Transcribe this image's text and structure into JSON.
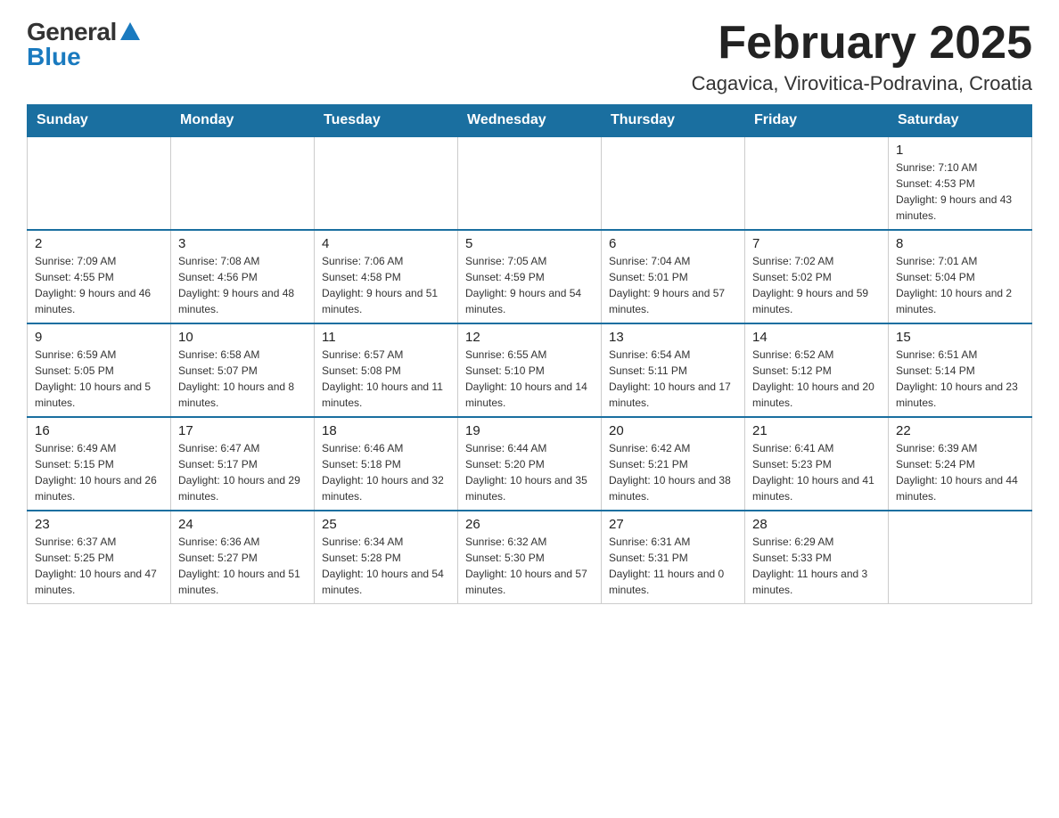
{
  "logo": {
    "general": "General",
    "blue": "Blue"
  },
  "header": {
    "month_year": "February 2025",
    "location": "Cagavica, Virovitica-Podravina, Croatia"
  },
  "weekdays": [
    "Sunday",
    "Monday",
    "Tuesday",
    "Wednesday",
    "Thursday",
    "Friday",
    "Saturday"
  ],
  "weeks": [
    [
      {
        "day": "",
        "info": ""
      },
      {
        "day": "",
        "info": ""
      },
      {
        "day": "",
        "info": ""
      },
      {
        "day": "",
        "info": ""
      },
      {
        "day": "",
        "info": ""
      },
      {
        "day": "",
        "info": ""
      },
      {
        "day": "1",
        "info": "Sunrise: 7:10 AM\nSunset: 4:53 PM\nDaylight: 9 hours and 43 minutes."
      }
    ],
    [
      {
        "day": "2",
        "info": "Sunrise: 7:09 AM\nSunset: 4:55 PM\nDaylight: 9 hours and 46 minutes."
      },
      {
        "day": "3",
        "info": "Sunrise: 7:08 AM\nSunset: 4:56 PM\nDaylight: 9 hours and 48 minutes."
      },
      {
        "day": "4",
        "info": "Sunrise: 7:06 AM\nSunset: 4:58 PM\nDaylight: 9 hours and 51 minutes."
      },
      {
        "day": "5",
        "info": "Sunrise: 7:05 AM\nSunset: 4:59 PM\nDaylight: 9 hours and 54 minutes."
      },
      {
        "day": "6",
        "info": "Sunrise: 7:04 AM\nSunset: 5:01 PM\nDaylight: 9 hours and 57 minutes."
      },
      {
        "day": "7",
        "info": "Sunrise: 7:02 AM\nSunset: 5:02 PM\nDaylight: 9 hours and 59 minutes."
      },
      {
        "day": "8",
        "info": "Sunrise: 7:01 AM\nSunset: 5:04 PM\nDaylight: 10 hours and 2 minutes."
      }
    ],
    [
      {
        "day": "9",
        "info": "Sunrise: 6:59 AM\nSunset: 5:05 PM\nDaylight: 10 hours and 5 minutes."
      },
      {
        "day": "10",
        "info": "Sunrise: 6:58 AM\nSunset: 5:07 PM\nDaylight: 10 hours and 8 minutes."
      },
      {
        "day": "11",
        "info": "Sunrise: 6:57 AM\nSunset: 5:08 PM\nDaylight: 10 hours and 11 minutes."
      },
      {
        "day": "12",
        "info": "Sunrise: 6:55 AM\nSunset: 5:10 PM\nDaylight: 10 hours and 14 minutes."
      },
      {
        "day": "13",
        "info": "Sunrise: 6:54 AM\nSunset: 5:11 PM\nDaylight: 10 hours and 17 minutes."
      },
      {
        "day": "14",
        "info": "Sunrise: 6:52 AM\nSunset: 5:12 PM\nDaylight: 10 hours and 20 minutes."
      },
      {
        "day": "15",
        "info": "Sunrise: 6:51 AM\nSunset: 5:14 PM\nDaylight: 10 hours and 23 minutes."
      }
    ],
    [
      {
        "day": "16",
        "info": "Sunrise: 6:49 AM\nSunset: 5:15 PM\nDaylight: 10 hours and 26 minutes."
      },
      {
        "day": "17",
        "info": "Sunrise: 6:47 AM\nSunset: 5:17 PM\nDaylight: 10 hours and 29 minutes."
      },
      {
        "day": "18",
        "info": "Sunrise: 6:46 AM\nSunset: 5:18 PM\nDaylight: 10 hours and 32 minutes."
      },
      {
        "day": "19",
        "info": "Sunrise: 6:44 AM\nSunset: 5:20 PM\nDaylight: 10 hours and 35 minutes."
      },
      {
        "day": "20",
        "info": "Sunrise: 6:42 AM\nSunset: 5:21 PM\nDaylight: 10 hours and 38 minutes."
      },
      {
        "day": "21",
        "info": "Sunrise: 6:41 AM\nSunset: 5:23 PM\nDaylight: 10 hours and 41 minutes."
      },
      {
        "day": "22",
        "info": "Sunrise: 6:39 AM\nSunset: 5:24 PM\nDaylight: 10 hours and 44 minutes."
      }
    ],
    [
      {
        "day": "23",
        "info": "Sunrise: 6:37 AM\nSunset: 5:25 PM\nDaylight: 10 hours and 47 minutes."
      },
      {
        "day": "24",
        "info": "Sunrise: 6:36 AM\nSunset: 5:27 PM\nDaylight: 10 hours and 51 minutes."
      },
      {
        "day": "25",
        "info": "Sunrise: 6:34 AM\nSunset: 5:28 PM\nDaylight: 10 hours and 54 minutes."
      },
      {
        "day": "26",
        "info": "Sunrise: 6:32 AM\nSunset: 5:30 PM\nDaylight: 10 hours and 57 minutes."
      },
      {
        "day": "27",
        "info": "Sunrise: 6:31 AM\nSunset: 5:31 PM\nDaylight: 11 hours and 0 minutes."
      },
      {
        "day": "28",
        "info": "Sunrise: 6:29 AM\nSunset: 5:33 PM\nDaylight: 11 hours and 3 minutes."
      },
      {
        "day": "",
        "info": ""
      }
    ]
  ]
}
